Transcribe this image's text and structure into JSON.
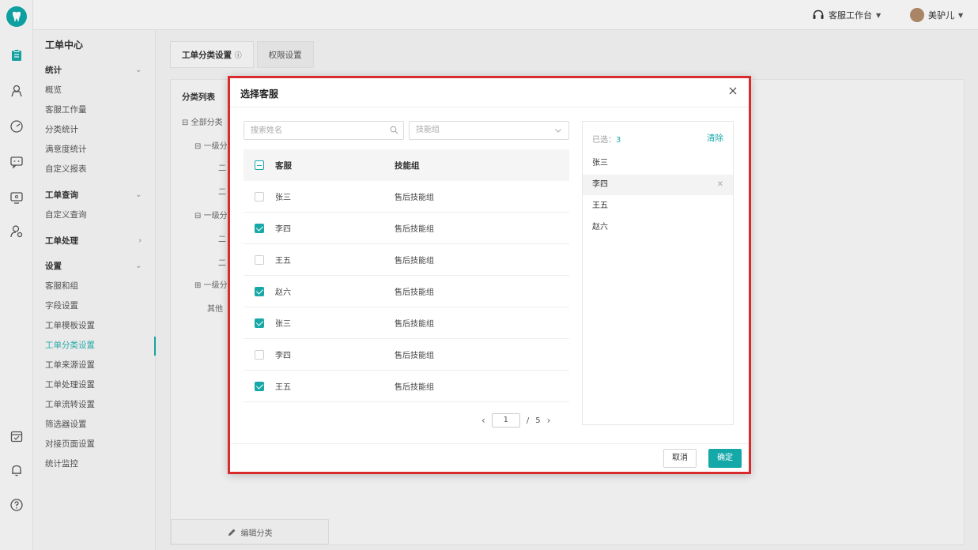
{
  "topbar": {
    "workspace": "客服工作台",
    "username": "美驴儿"
  },
  "subnav": {
    "title": "工单中心",
    "groups": [
      {
        "label": "统计",
        "items": [
          "概览",
          "客服工作量",
          "分类统计",
          "满意度统计",
          "自定义报表"
        ]
      },
      {
        "label": "工单查询",
        "items": [
          "自定义查询"
        ]
      },
      {
        "label": "工单处理",
        "items": []
      },
      {
        "label": "设置",
        "items": [
          "客服和组",
          "字段设置",
          "工单模板设置",
          "工单分类设置",
          "工单来源设置",
          "工单处理设置",
          "工单流转设置",
          "筛选器设置",
          "对接页面设置",
          "统计监控"
        ]
      }
    ],
    "active_item": "工单分类设置"
  },
  "main": {
    "tabs": [
      {
        "label": "工单分类设置"
      },
      {
        "label": "权限设置"
      }
    ],
    "panel_title": "分类列表",
    "tree": [
      "全部分类",
      "一级分",
      "二",
      "二",
      "一级分",
      "二",
      "二",
      "一级分",
      "其他"
    ],
    "edit_button": "编辑分类"
  },
  "modal": {
    "title": "选择客服",
    "search_placeholder": "搜索姓名",
    "group_placeholder": "技能组",
    "columns": {
      "name": "客服",
      "group": "技能组"
    },
    "rows": [
      {
        "name": "张三",
        "group": "售后技能组",
        "checked": false
      },
      {
        "name": "李四",
        "group": "售后技能组",
        "checked": true
      },
      {
        "name": "王五",
        "group": "售后技能组",
        "checked": false
      },
      {
        "name": "赵六",
        "group": "售后技能组",
        "checked": true
      },
      {
        "name": "张三",
        "group": "售后技能组",
        "checked": true
      },
      {
        "name": "李四",
        "group": "售后技能组",
        "checked": false
      },
      {
        "name": "王五",
        "group": "售后技能组",
        "checked": true
      }
    ],
    "pager": {
      "current": "1",
      "separator": "/",
      "total": "5"
    },
    "selected": {
      "label": "已选：",
      "count": "3",
      "clear": "清除",
      "items": [
        "张三",
        "李四",
        "王五",
        "赵六"
      ]
    },
    "cancel": "取消",
    "confirm": "确定"
  },
  "colors": {
    "accent": "#15a8a8",
    "highlight_border": "#d92b2b"
  }
}
